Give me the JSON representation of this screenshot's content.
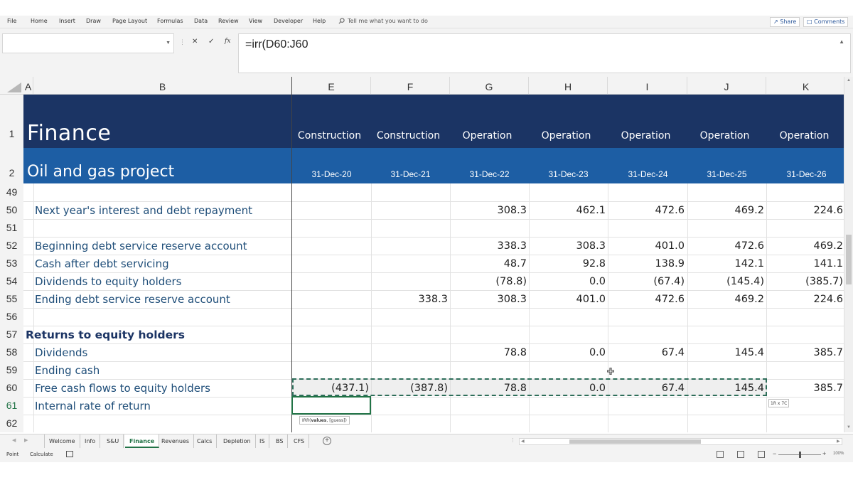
{
  "ribbon": {
    "tabs": [
      "File",
      "Home",
      "Insert",
      "Draw",
      "Page Layout",
      "Formulas",
      "Data",
      "Review",
      "View",
      "Developer",
      "Help"
    ],
    "tell_me": "Tell me what you want to do",
    "share": "Share",
    "comments": "Comments"
  },
  "formula_bar": {
    "name_box": "",
    "formula": "=irr(D60:J60"
  },
  "columns": [
    "A",
    "B",
    "E",
    "F",
    "G",
    "H",
    "I",
    "J",
    "K"
  ],
  "header": {
    "row1_label": "1",
    "row2_label": "2",
    "title": "Finance",
    "subtitle": "Oil and gas project",
    "phases": [
      "Construction",
      "Construction",
      "Operation",
      "Operation",
      "Operation",
      "Operation",
      "Operation"
    ],
    "dates": [
      "31-Dec-20",
      "31-Dec-21",
      "31-Dec-22",
      "31-Dec-23",
      "31-Dec-24",
      "31-Dec-25",
      "31-Dec-26"
    ]
  },
  "rows": [
    {
      "num": "49",
      "label": "",
      "values": [
        "",
        "",
        "",
        "",
        "",
        "",
        ""
      ]
    },
    {
      "num": "50",
      "label": "Next year's interest and debt repayment",
      "values": [
        "",
        "",
        "308.3",
        "462.1",
        "472.6",
        "469.2",
        "224.6"
      ]
    },
    {
      "num": "51",
      "label": "",
      "values": [
        "",
        "",
        "",
        "",
        "",
        "",
        ""
      ]
    },
    {
      "num": "52",
      "label": "Beginning debt service reserve account",
      "values": [
        "",
        "",
        "338.3",
        "308.3",
        "401.0",
        "472.6",
        "469.2"
      ]
    },
    {
      "num": "53",
      "label": "Cash after debt servicing",
      "values": [
        "",
        "",
        "48.7",
        "92.8",
        "138.9",
        "142.1",
        "141.1"
      ]
    },
    {
      "num": "54",
      "label": "Dividends to equity holders",
      "values": [
        "",
        "",
        "(78.8)",
        "0.0",
        "(67.4)",
        "(145.4)",
        "(385.7)"
      ]
    },
    {
      "num": "55",
      "label": "Ending debt service reserve account",
      "values": [
        "",
        "338.3",
        "308.3",
        "401.0",
        "472.6",
        "469.2",
        "224.6"
      ]
    },
    {
      "num": "56",
      "label": "",
      "values": [
        "",
        "",
        "",
        "",
        "",
        "",
        ""
      ]
    },
    {
      "num": "57",
      "label": "Returns to equity holders",
      "heading": true,
      "values": [
        "",
        "",
        "",
        "",
        "",
        "",
        ""
      ]
    },
    {
      "num": "58",
      "label": "Dividends",
      "values": [
        "",
        "",
        "78.8",
        "0.0",
        "67.4",
        "145.4",
        "385.7"
      ]
    },
    {
      "num": "59",
      "label": "Ending cash",
      "values": [
        "",
        "",
        "",
        "",
        "",
        "",
        ""
      ]
    },
    {
      "num": "60",
      "label": "Free cash flows to equity holders",
      "values": [
        "(437.1)",
        "(387.8)",
        "78.8",
        "0.0",
        "67.4",
        "145.4",
        "385.7"
      ]
    },
    {
      "num": "61",
      "label": "Internal rate of return",
      "active": true,
      "values": [
        "",
        "",
        "",
        "",
        "",
        "",
        ""
      ]
    },
    {
      "num": "62",
      "label": "",
      "values": [
        "",
        "",
        "",
        "",
        "",
        "",
        ""
      ]
    }
  ],
  "function_tooltip": {
    "name": "IRR(",
    "arg1": "values",
    "rest": ", [guess])"
  },
  "selection_size": "1R x 7C",
  "sheet_tabs": {
    "tabs": [
      "Welcome",
      "Info",
      "S&U",
      "Finance",
      "Revenues",
      "Calcs",
      "Depletion",
      "IS",
      "BS",
      "CFS"
    ],
    "active": "Finance"
  },
  "status": {
    "mode": "Point",
    "calc": "Calculate",
    "zoom": "100%"
  },
  "colors": {
    "band_dark": "#1b3464",
    "band_mid": "#1d5ea4",
    "label_blue": "#1f4e79",
    "excel_green": "#217346"
  }
}
